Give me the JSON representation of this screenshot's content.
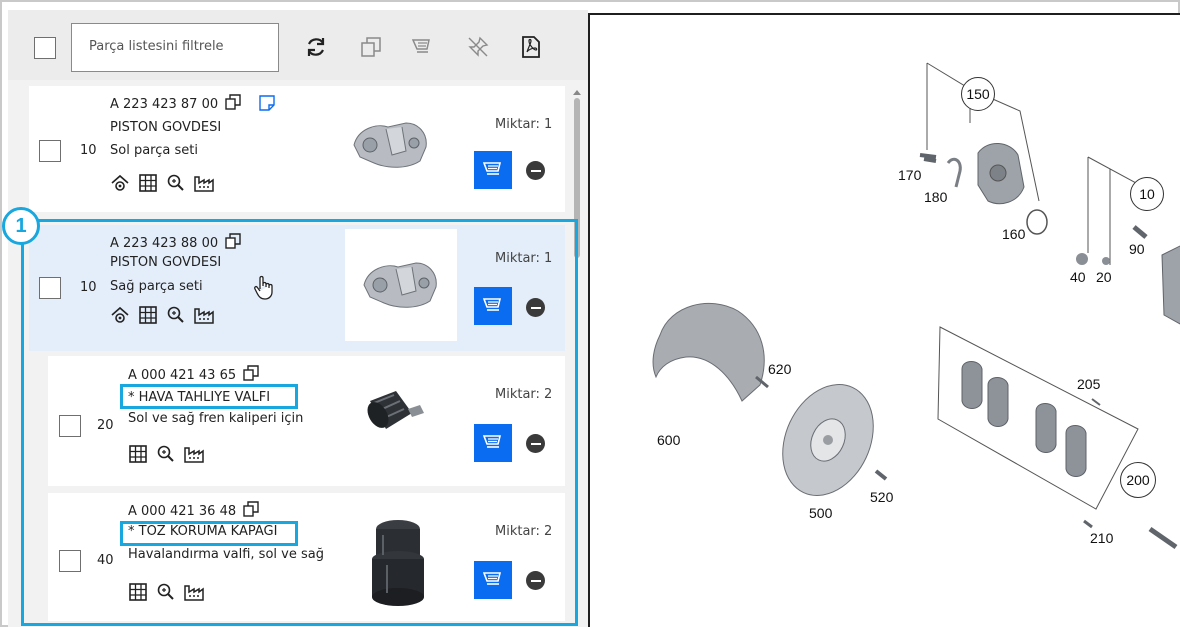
{
  "toolbar": {
    "filter_placeholder": "Parça listesini filtrele",
    "icons": [
      "refresh-icon",
      "copy-icon",
      "cart-icon",
      "unpin-icon",
      "pdf-icon"
    ]
  },
  "callout_number": "1",
  "parts": [
    {
      "part_number": "A 223 423 87 00",
      "name": "PISTON GOVDESI",
      "position": "10",
      "description": "Sol parça seti",
      "quantity": "Miktar: 1"
    },
    {
      "part_number": "A 223 423 88 00",
      "name": "PISTON GOVDESI",
      "position": "10",
      "description": "Sağ parça seti",
      "quantity": "Miktar: 1"
    },
    {
      "part_number": "A 000 421 43 65",
      "name": "* HAVA TAHLIYE VALFI",
      "position": "20",
      "description": "Sol ve sağ fren kaliperi için",
      "quantity": "Miktar: 2"
    },
    {
      "part_number": "A 000 421 36 48",
      "name": "* TOZ KORUMA KAPAGI",
      "position": "40",
      "description": "Havalandırma valfi, sol ve sağ",
      "quantity": "Miktar: 2"
    }
  ],
  "diagram": {
    "circle_labels": [
      "150",
      "10",
      "200"
    ],
    "labels": [
      "170",
      "180",
      "160",
      "90",
      "40",
      "20",
      "620",
      "600",
      "500",
      "520",
      "205",
      "210"
    ]
  }
}
